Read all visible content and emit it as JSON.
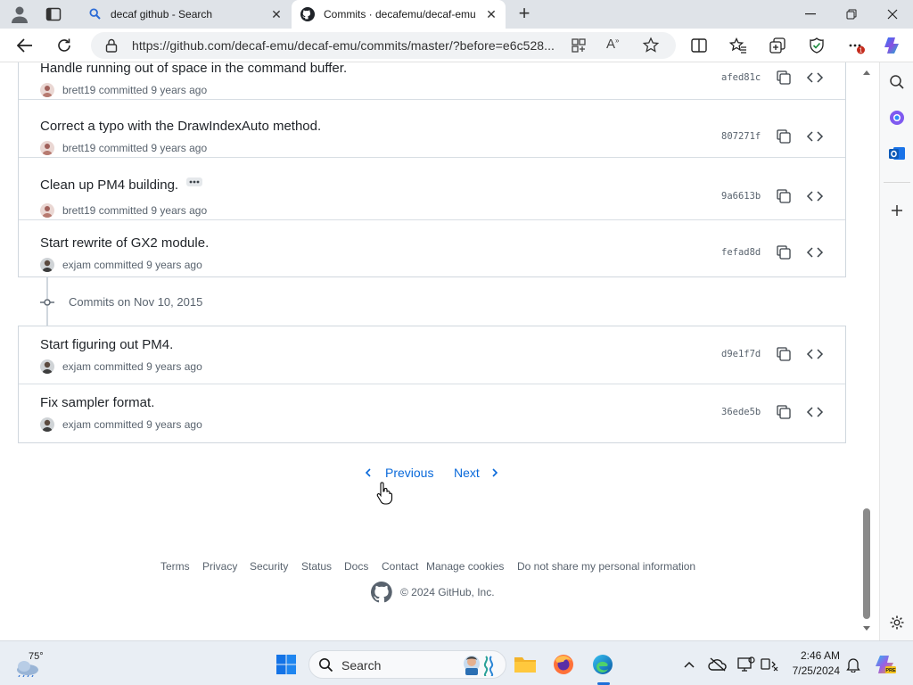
{
  "browser": {
    "tabs": [
      {
        "title": "decaf github - Search",
        "active": false,
        "icon": "search-icon"
      },
      {
        "title": "Commits · decafemu/decaf-emu",
        "active": true,
        "icon": "github-icon"
      }
    ],
    "url": "https://github.com/decaf-emu/decaf-emu/commits/master/?before=e6c528..."
  },
  "commits_group_1": [
    {
      "message": "Handle running out of space in the command buffer.",
      "author": "brett19",
      "verb": "committed",
      "time": "9 years ago",
      "sha": "afed81c"
    },
    {
      "message": "Correct a typo with the DrawIndexAuto method.",
      "author": "brett19",
      "verb": "committed",
      "time": "9 years ago",
      "sha": "807271f"
    },
    {
      "message": "Clean up PM4 building.",
      "author": "brett19",
      "verb": "committed",
      "time": "9 years ago",
      "sha": "9a6613b",
      "has_more": true
    },
    {
      "message": "Start rewrite of GX2 module.",
      "author": "exjam",
      "verb": "committed",
      "time": "9 years ago",
      "sha": "fefad8d"
    }
  ],
  "date_header": "Commits on Nov 10, 2015",
  "commits_group_2": [
    {
      "message": "Start figuring out PM4.",
      "author": "exjam",
      "verb": "committed",
      "time": "9 years ago",
      "sha": "d9e1f7d"
    },
    {
      "message": "Fix sampler format.",
      "author": "exjam",
      "verb": "committed",
      "time": "9 years ago",
      "sha": "36ede5b"
    }
  ],
  "pagination": {
    "previous": "Previous",
    "next": "Next"
  },
  "footer": {
    "links": [
      "Terms",
      "Privacy",
      "Security",
      "Status",
      "Docs",
      "Contact",
      "Manage cookies",
      "Do not share my personal information"
    ],
    "copyright": "© 2024 GitHub, Inc."
  },
  "taskbar": {
    "weather": "75°",
    "search_placeholder": "Search",
    "time": "2:46 AM",
    "date": "7/25/2024"
  },
  "colors": {
    "link": "#0969da",
    "text": "#1f2328",
    "muted": "#59636e",
    "border": "#d0d7de",
    "edge_blue": "#1a73e8"
  }
}
